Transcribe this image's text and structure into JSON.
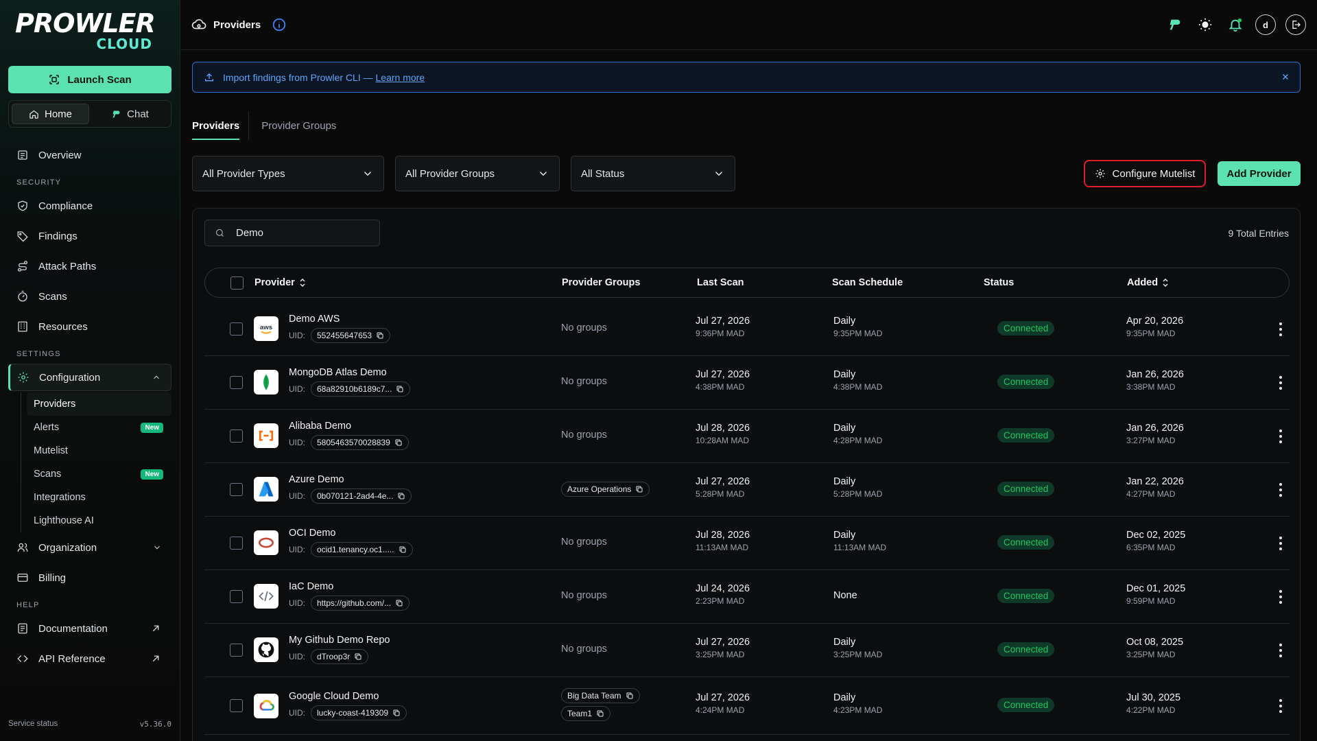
{
  "brand": {
    "name": "PROWLER",
    "sub": "CLOUD"
  },
  "sidebar": {
    "launch_label": "Launch Scan",
    "seg": {
      "home": "Home",
      "chat": "Chat"
    },
    "overview": "Overview",
    "security_label": "SECURITY",
    "security_items": [
      "Compliance",
      "Findings",
      "Attack Paths",
      "Scans",
      "Resources"
    ],
    "settings_label": "SETTINGS",
    "configuration": "Configuration",
    "config_sub": [
      {
        "label": "Providers",
        "badge": ""
      },
      {
        "label": "Alerts",
        "badge": "New"
      },
      {
        "label": "Mutelist",
        "badge": ""
      },
      {
        "label": "Scans",
        "badge": "New"
      },
      {
        "label": "Integrations",
        "badge": ""
      },
      {
        "label": "Lighthouse AI",
        "badge": ""
      }
    ],
    "organization": "Organization",
    "billing": "Billing",
    "help_label": "HELP",
    "documentation": "Documentation",
    "api_reference": "API Reference",
    "footer_status": "Service status",
    "version": "v5.36.0"
  },
  "topbar": {
    "title": "Providers",
    "avatar": "d"
  },
  "banner": {
    "text": "Import findings from Prowler CLI — ",
    "link": "Learn more"
  },
  "tabs": [
    "Providers",
    "Provider Groups"
  ],
  "filters": {
    "types": "All Provider Types",
    "groups": "All Provider Groups",
    "status": "All Status"
  },
  "actions": {
    "mutelist": "Configure Mutelist",
    "add": "Add Provider"
  },
  "search": {
    "value": "Demo"
  },
  "total": "9 Total Entries",
  "columns": {
    "provider": "Provider",
    "groups": "Provider Groups",
    "last_scan": "Last Scan",
    "schedule": "Scan Schedule",
    "status": "Status",
    "added": "Added"
  },
  "uid_label": "UID:",
  "rows": [
    {
      "name": "Demo AWS",
      "logo": "aws-logo",
      "uid": "552455647653",
      "groups": [],
      "no_groups": "No groups",
      "last_scan_date": "Jul 27, 2026",
      "last_scan_time": "9:36PM MAD",
      "schedule": "Daily",
      "schedule_time": "9:35PM MAD",
      "status": "Connected",
      "added_date": "Apr 20, 2026",
      "added_time": "9:35PM MAD"
    },
    {
      "name": "MongoDB Atlas Demo",
      "logo": "mongodb-logo",
      "uid": "68a82910b6189c7...",
      "groups": [],
      "no_groups": "No groups",
      "last_scan_date": "Jul 27, 2026",
      "last_scan_time": "4:38PM MAD",
      "schedule": "Daily",
      "schedule_time": "4:38PM MAD",
      "status": "Connected",
      "added_date": "Jan 26, 2026",
      "added_time": "3:38PM MAD"
    },
    {
      "name": "Alibaba Demo",
      "logo": "alibaba-logo",
      "uid": "5805463570028839",
      "groups": [],
      "no_groups": "No groups",
      "last_scan_date": "Jul 28, 2026",
      "last_scan_time": "10:28AM MAD",
      "schedule": "Daily",
      "schedule_time": "4:28PM MAD",
      "status": "Connected",
      "added_date": "Jan 26, 2026",
      "added_time": "3:27PM MAD"
    },
    {
      "name": "Azure Demo",
      "logo": "azure-logo",
      "uid": "0b070121-2ad4-4e...",
      "groups": [
        "Azure Operations"
      ],
      "no_groups": "",
      "last_scan_date": "Jul 27, 2026",
      "last_scan_time": "5:28PM MAD",
      "schedule": "Daily",
      "schedule_time": "5:28PM MAD",
      "status": "Connected",
      "added_date": "Jan 22, 2026",
      "added_time": "4:27PM MAD"
    },
    {
      "name": "OCI Demo",
      "logo": "oci-logo",
      "uid": "ocid1.tenancy.oc1.....",
      "groups": [],
      "no_groups": "No groups",
      "last_scan_date": "Jul 28, 2026",
      "last_scan_time": "11:13AM MAD",
      "schedule": "Daily",
      "schedule_time": "11:13AM MAD",
      "status": "Connected",
      "added_date": "Dec 02, 2025",
      "added_time": "6:35PM MAD"
    },
    {
      "name": "IaC Demo",
      "logo": "iac-logo",
      "uid": "https://github.com/...",
      "groups": [],
      "no_groups": "No groups",
      "last_scan_date": "Jul 24, 2026",
      "last_scan_time": "2:23PM MAD",
      "schedule": "None",
      "schedule_time": "",
      "status": "Connected",
      "added_date": "Dec 01, 2025",
      "added_time": "9:59PM MAD"
    },
    {
      "name": "My Github Demo Repo",
      "logo": "github-logo",
      "uid": "dTroop3r",
      "groups": [],
      "no_groups": "No groups",
      "last_scan_date": "Jul 27, 2026",
      "last_scan_time": "3:25PM MAD",
      "schedule": "Daily",
      "schedule_time": "3:25PM MAD",
      "status": "Connected",
      "added_date": "Oct 08, 2025",
      "added_time": "3:25PM MAD"
    },
    {
      "name": "Google Cloud Demo",
      "logo": "gcp-logo",
      "uid": "lucky-coast-419309",
      "groups": [
        "Big Data Team",
        "Team1"
      ],
      "no_groups": "",
      "last_scan_date": "Jul 27, 2026",
      "last_scan_time": "4:24PM MAD",
      "schedule": "Daily",
      "schedule_time": "4:23PM MAD",
      "status": "Connected",
      "added_date": "Jul 30, 2025",
      "added_time": "4:22PM MAD"
    }
  ]
}
